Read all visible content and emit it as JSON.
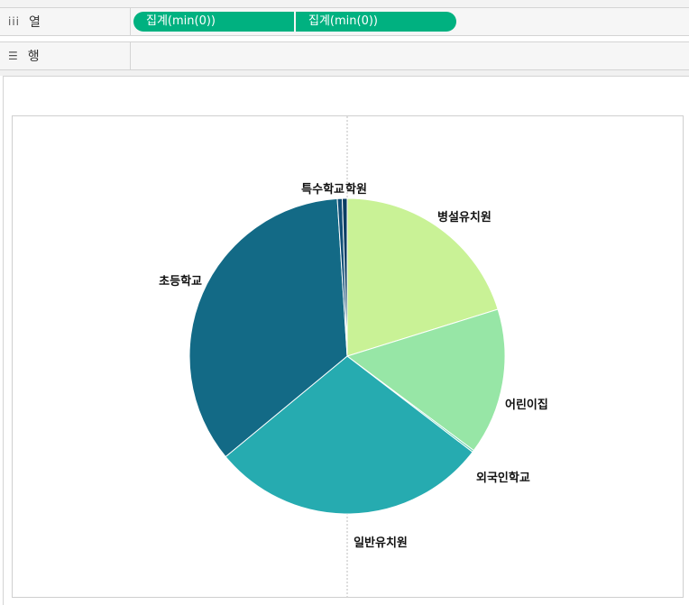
{
  "shelves": {
    "columns": {
      "icon": "columns-icon",
      "label": "열",
      "pills": [
        "집계(min(0))",
        "집계(min(0))"
      ]
    },
    "rows": {
      "icon": "rows-icon",
      "label": "행"
    }
  },
  "colors": {
    "pill": "#00b180"
  },
  "chart_data": {
    "type": "pie",
    "title": "",
    "slices": [
      {
        "label": "병설유치원",
        "value": 20.2,
        "color": "#c9f296"
      },
      {
        "label": "어린이집",
        "value": 15.0,
        "color": "#97e6a6"
      },
      {
        "label": "외국인학교",
        "value": 0.2,
        "color": "#5fd0ae"
      },
      {
        "label": "일반유치원",
        "value": 28.6,
        "color": "#26abb0"
      },
      {
        "label": "초등학교",
        "value": 35.0,
        "color": "#136a86"
      },
      {
        "label": "특수학교",
        "value": 0.5,
        "color": "#0f4f77"
      },
      {
        "label": "학원",
        "value": 0.5,
        "color": "#0a3d63"
      }
    ],
    "legend": "none"
  }
}
